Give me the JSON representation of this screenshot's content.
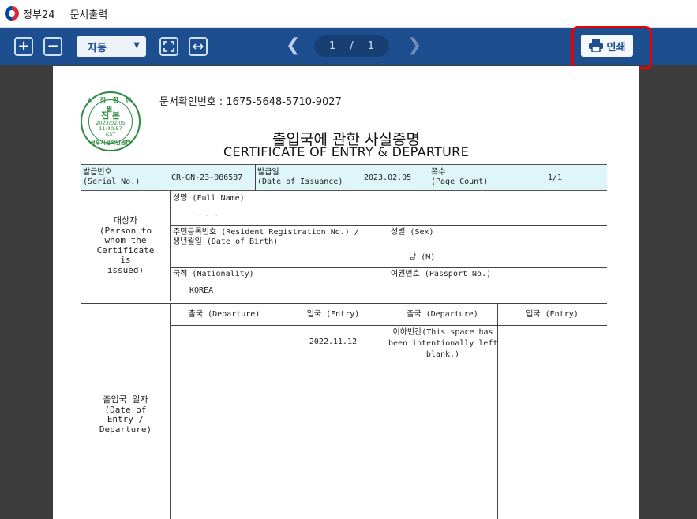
{
  "titlebar": {
    "app_name": "정부24",
    "title": "문서출력"
  },
  "toolbar": {
    "zoom_in": "+",
    "zoom_out": "−",
    "zoom_value": "자동",
    "current_page": "1",
    "page_sep": "/",
    "total_pages": "1",
    "print_label": "인쇄",
    "prev": "❮",
    "next": "❯"
  },
  "stamp": {
    "top": "시 점 확 인 필",
    "main": "진 본",
    "date": "2023/02/05",
    "time": "11:40:57",
    "tz": "KST",
    "bottom": "정부시점확인센터"
  },
  "document": {
    "doc_number": "문서확인번호 : 1675-5648-5710-9027",
    "title_ko": "출입국에 관한 사실증명",
    "title_en": "CERTIFICATE OF ENTRY & DEPARTURE",
    "serial_label": "발급번호\n(Serial No.)",
    "serial_value": "CR-GN-23-086587",
    "issue_label": "발급일\n(Date of Issuance)",
    "issue_value": "2023.02.05",
    "page_label": "쪽수\n(Page Count)",
    "page_value": "1/1",
    "subject_label": "대상자\n(Person to\nwhom the\nCertificate\nis\nissued)",
    "name_label": "성명 (Full Name)",
    "name_value": "· · ·",
    "rrn_label": "주민등록번호 (Resident Registration No.) /\n생년월일 (Date of Birth)",
    "sex_label": "성별 (Sex)",
    "sex_value": "남 (M)",
    "nationality_label": "국적 (Nationality)",
    "nationality_value": "KOREA",
    "passport_label": "여권번호 (Passport No.)",
    "dates_label": "출입국 일자\n(Date of\nEntry /\nDeparture)",
    "col_departure_1": "출국 (Departure)",
    "col_entry_1": "입국 (Entry)",
    "col_departure_2": "출국 (Departure)",
    "col_entry_2": "입국 (Entry)",
    "entry_date_1": "2022.11.12",
    "blank_note": "이하빈칸(This space has\nbeen intentionally left\nblank.)"
  }
}
